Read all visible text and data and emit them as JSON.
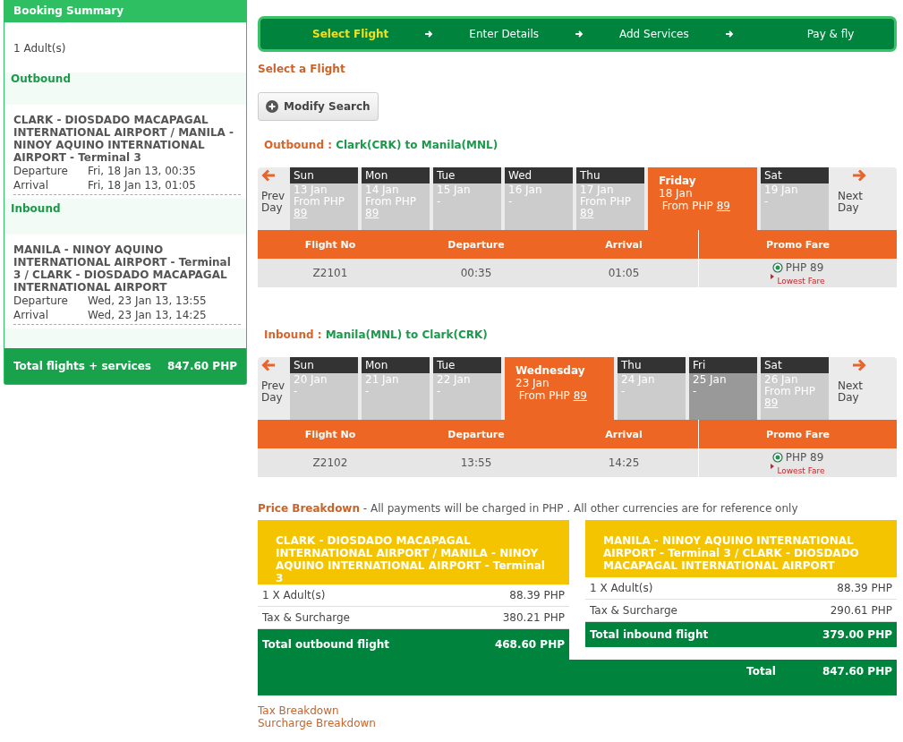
{
  "booking_summary": {
    "title": "Booking Summary",
    "passengers": "1 Adult(s)",
    "legs": [
      {
        "heading": "Outbound",
        "route": "CLARK - DIOSDADO MACAPAGAL INTERNATIONAL AIRPORT / MANILA - NINOY AQUINO INTERNATIONAL AIRPORT - Terminal 3",
        "departure_label": "Departure",
        "departure": "Fri, 18 Jan 13, 00:35",
        "arrival_label": "Arrival",
        "arrival": "Fri, 18 Jan 13,  01:05"
      },
      {
        "heading": "Inbound",
        "route": "MANILA - NINOY AQUINO INTERNATIONAL AIRPORT - Terminal 3 / CLARK - DIOSDADO MACAPAGAL INTERNATIONAL AIRPORT",
        "departure_label": "Departure",
        "departure": "Wed, 23 Jan 13,  13:55",
        "arrival_label": "Arrival",
        "arrival": "Wed, 23 Jan 13,  14:25"
      }
    ],
    "total_label": "Total flights + services",
    "total": "847.60 PHP"
  },
  "steps": [
    {
      "label": "Select Flight",
      "selected": true
    },
    {
      "label": "Enter Details",
      "selected": false
    },
    {
      "label": "Add Services",
      "selected": false
    },
    {
      "label": "Pay & fly",
      "selected": false
    }
  ],
  "section_title": "Select a Flight",
  "modify_button": "Modify Search",
  "journeys": [
    {
      "direction": "Outbound :",
      "route": "Clark(CRK) to Manila(MNL)",
      "prev": "Prev Day",
      "next": "Next Day",
      "days": [
        {
          "day": "Sun",
          "date": "13 Jan",
          "fare_label": "From PHP",
          "fare": "89",
          "selected": false,
          "dimmed": false
        },
        {
          "day": "Mon",
          "date": "14 Jan",
          "fare_label": "From PHP",
          "fare": "89",
          "selected": false,
          "dimmed": false
        },
        {
          "day": "Tue",
          "date": "15 Jan",
          "fare": "-",
          "selected": false,
          "dimmed": false
        },
        {
          "day": "Wed",
          "date": "16 Jan",
          "fare": "-",
          "selected": false,
          "dimmed": false
        },
        {
          "day": "Thu",
          "date": "17 Jan",
          "fare_label": "From PHP",
          "fare": "89",
          "selected": false,
          "dimmed": false
        },
        {
          "day": "Friday",
          "date": "18 Jan",
          "fare_label": "From PHP",
          "fare": "89",
          "selected": true,
          "dimmed": false
        },
        {
          "day": "Sat",
          "date": "19 Jan",
          "fare": "-",
          "selected": false,
          "dimmed": false
        }
      ],
      "columns": [
        "Flight No",
        "Departure",
        "Arrival",
        "Promo Fare"
      ],
      "flights": [
        {
          "flight_no": "Z2101",
          "departure": "00:35",
          "arrival": "01:05",
          "fare": "PHP 89",
          "note": "Lowest Fare",
          "selected": true
        }
      ]
    },
    {
      "direction": "Inbound :",
      "route": "Manila(MNL) to Clark(CRK)",
      "prev": "Prev Day",
      "next": "Next Day",
      "days": [
        {
          "day": "Sun",
          "date": "20 Jan",
          "fare": "-",
          "selected": false,
          "dimmed": false
        },
        {
          "day": "Mon",
          "date": "21 Jan",
          "fare": "-",
          "selected": false,
          "dimmed": false
        },
        {
          "day": "Tue",
          "date": "22 Jan",
          "fare": "-",
          "selected": false,
          "dimmed": false
        },
        {
          "day": "Wednesday",
          "date": "23 Jan",
          "fare_label": "From PHP",
          "fare": "89",
          "selected": true,
          "dimmed": false
        },
        {
          "day": "Thu",
          "date": "24 Jan",
          "fare": "-",
          "selected": false,
          "dimmed": false
        },
        {
          "day": "Fri",
          "date": "25 Jan",
          "fare": "-",
          "selected": false,
          "dimmed": true
        },
        {
          "day": "Sat",
          "date": "26 Jan",
          "fare_label": "From PHP",
          "fare": "89",
          "selected": false,
          "dimmed": false
        }
      ],
      "columns": [
        "Flight No",
        "Departure",
        "Arrival",
        "Promo Fare"
      ],
      "flights": [
        {
          "flight_no": "Z2102",
          "departure": "13:55",
          "arrival": "14:25",
          "fare": "PHP 89",
          "note": "Lowest Fare",
          "selected": true
        }
      ]
    }
  ],
  "price_breakdown": {
    "title": "Price Breakdown",
    "note": "- All payments will be charged in PHP . All other currencies are for reference only",
    "legs": [
      {
        "route": "CLARK - DIOSDADO MACAPAGAL INTERNATIONAL AIRPORT / MANILA - NINOY AQUINO INTERNATIONAL AIRPORT - Terminal 3",
        "lines": [
          {
            "label": "1 X Adult(s)",
            "amount": "88.39 PHP"
          },
          {
            "label": "Tax & Surcharge",
            "amount": "380.21 PHP"
          }
        ],
        "total_label": "Total outbound flight",
        "total": "468.60 PHP"
      },
      {
        "route": "MANILA - NINOY AQUINO INTERNATIONAL AIRPORT - Terminal 3 / CLARK - DIOSDADO MACAPAGAL INTERNATIONAL AIRPORT",
        "lines": [
          {
            "label": "1 X Adult(s)",
            "amount": "88.39 PHP"
          },
          {
            "label": "Tax & Surcharge",
            "amount": "290.61 PHP"
          }
        ],
        "total_label": "Total inbound flight",
        "total": "379.00 PHP"
      }
    ],
    "total_label": "Total",
    "total": "847.60 PHP"
  },
  "links": [
    "Tax Breakdown",
    "Surcharge Breakdown"
  ]
}
